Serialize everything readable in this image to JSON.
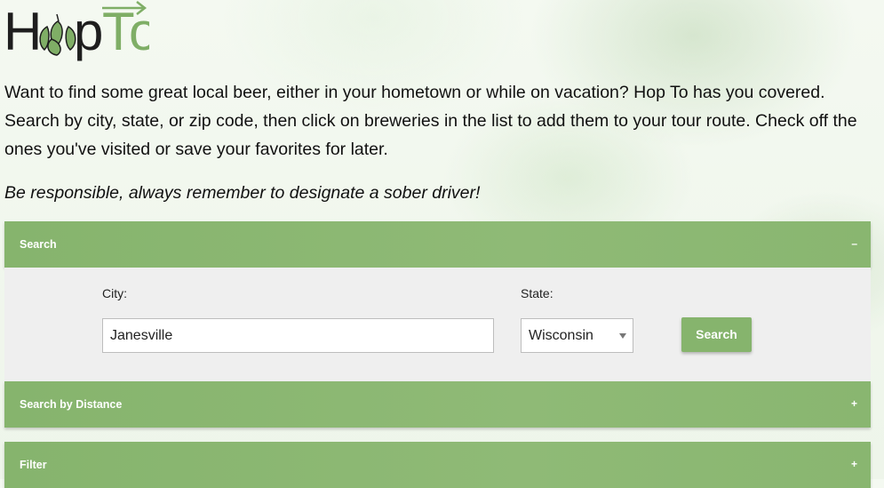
{
  "brand": {
    "name": "HopTo",
    "name_part1": "H",
    "name_part2": "p",
    "name_part3": "To"
  },
  "intro": {
    "description": "Want to find some great local beer, either in your hometown or while on vacation? Hop To has you covered. Search by city, state, or zip code, then click on breweries in the list to add them to your tour route. Check off the ones you've visited or save your favorites for later.",
    "warning": "Be responsible, always remember to designate a sober driver!"
  },
  "search_panel": {
    "title": "Search",
    "toggle": "–",
    "city_label": "City:",
    "city_value": "Janesville",
    "state_label": "State:",
    "state_value": "Wisconsin",
    "button_label": "Search"
  },
  "distance_panel": {
    "title": "Search by Distance",
    "toggle": "+"
  },
  "filter_panel": {
    "title": "Filter",
    "toggle": "+"
  },
  "colors": {
    "accent": "#8ab872",
    "panel_bg": "#efefef",
    "logo_dark": "#1e1e1e",
    "logo_green": "#7fae66"
  },
  "icons": {
    "logo_hop": "hop-cone-icon",
    "logo_arrow": "arrow-right-icon",
    "select_arrow": "chevron-down-icon"
  }
}
